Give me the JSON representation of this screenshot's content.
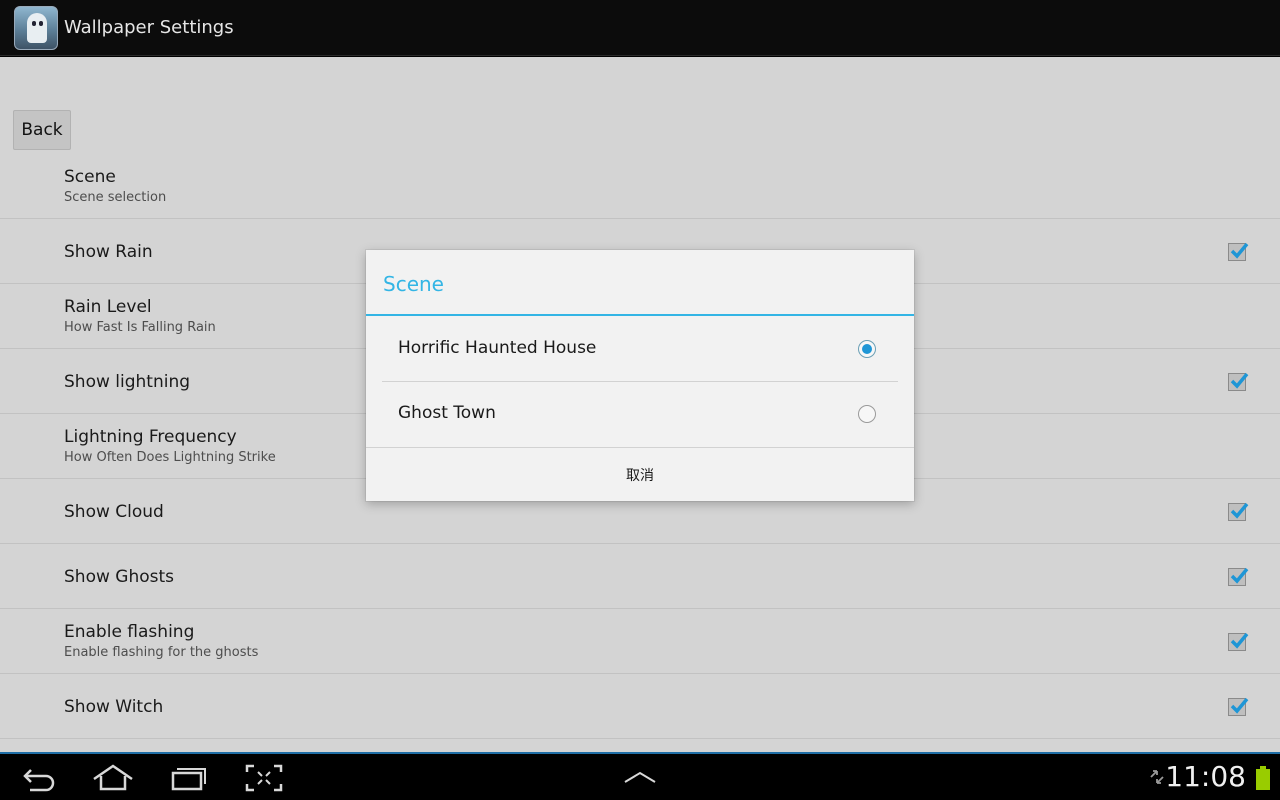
{
  "app": {
    "title": "Wallpaper Settings",
    "icon": "ghost-app-icon"
  },
  "back_button": {
    "label": "Back"
  },
  "preferences": [
    {
      "title": "Scene",
      "summary": "Scene selection",
      "has_checkbox": false
    },
    {
      "title": "Show Rain",
      "summary": "",
      "has_checkbox": true,
      "checked": true
    },
    {
      "title": "Rain Level",
      "summary": "How Fast Is Falling Rain",
      "has_checkbox": false
    },
    {
      "title": "Show lightning",
      "summary": "",
      "has_checkbox": true,
      "checked": true
    },
    {
      "title": "Lightning Frequency",
      "summary": "How Often Does Lightning Strike",
      "has_checkbox": false
    },
    {
      "title": "Show Cloud",
      "summary": "",
      "has_checkbox": true,
      "checked": true
    },
    {
      "title": "Show Ghosts",
      "summary": "",
      "has_checkbox": true,
      "checked": true
    },
    {
      "title": "Enable flashing",
      "summary": "Enable flashing for the ghosts",
      "has_checkbox": true,
      "checked": true
    },
    {
      "title": "Show Witch",
      "summary": "",
      "has_checkbox": true,
      "checked": true
    }
  ],
  "dialog": {
    "title": "Scene",
    "options": [
      {
        "label": "Horrific Haunted House",
        "selected": true
      },
      {
        "label": "Ghost Town",
        "selected": false
      }
    ],
    "cancel_label": "取消"
  },
  "system_bar": {
    "clock": "11:08",
    "nav_icons": [
      "back-icon",
      "home-icon",
      "recent-apps-icon",
      "screenshot-icon"
    ],
    "center_icon": "chevron-up-icon",
    "status_icons": [
      "sync-icon",
      "battery-icon"
    ]
  },
  "colors": {
    "accent": "#33b5e5",
    "checkbox_blue": "#1e96d6",
    "battery": "#99cc00",
    "nav_bar_edge": "#1f6ea6"
  }
}
